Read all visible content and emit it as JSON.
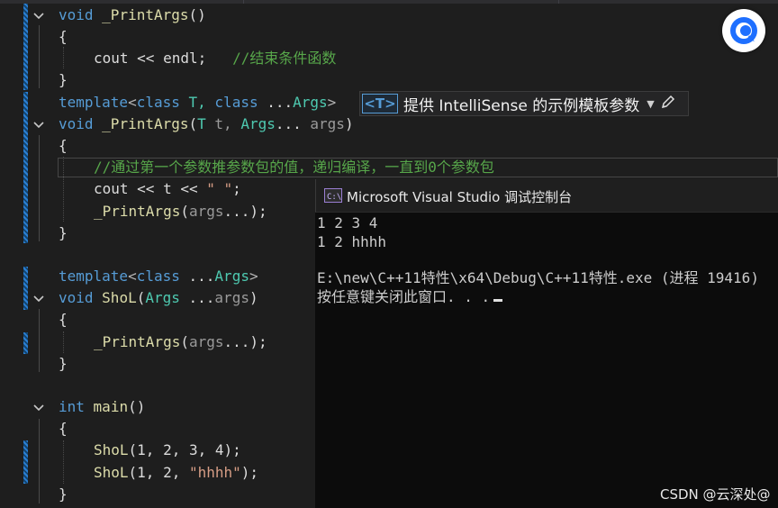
{
  "editor": {
    "lines": {
      "l1": {
        "kw": "void",
        "fn": "_PrintArgs",
        "rest": "()"
      },
      "l2": {
        "text": "{"
      },
      "l3": {
        "a": "cout << endl;",
        "cm": "//结束条件函数"
      },
      "l4": {
        "text": "}"
      },
      "l5": {
        "kw1": "template",
        "p1": "<",
        "kw2": "class",
        "t": "T,",
        "kw3": "class",
        "e": "...",
        "ty": "Args",
        "p2": ">"
      },
      "l6": {
        "kw": "void",
        "fn": "_PrintArgs",
        "a": "(",
        "ty1": "T",
        "pm1": "t,",
        "ty2": "Args",
        "b": "...",
        "pm2": "args",
        ")": ")"
      },
      "l7": {
        "text": "{"
      },
      "l8": {
        "cm": "//通过第一个参数推参数包的值，递归编译，一直到0个参数包"
      },
      "l9": {
        "a": "cout << t << ",
        "str": "\" \"",
        "b": ";"
      },
      "l10": {
        "fn": "_PrintArgs",
        "a": "(",
        "pm": "args",
        "b": "...);"
      },
      "l11": {
        "text": "}"
      },
      "l12": {
        "kw1": "template",
        "p1": "<",
        "kw2": "class",
        "e": "...",
        "ty": "Args",
        "p2": ">"
      },
      "l13": {
        "kw": "void",
        "fn": "ShoL",
        "a": "(",
        "ty": "Args",
        "b": "...",
        "pm": "args",
        ")": ")"
      },
      "l14": {
        "text": "{"
      },
      "l15": {
        "fn": "_PrintArgs",
        "a": "(",
        "pm": "args",
        "b": "...);"
      },
      "l16": {
        "text": "}"
      },
      "l17": {
        "kw": "int",
        "fn": "main",
        "rest": "()"
      },
      "l18": {
        "text": "{"
      },
      "l19": {
        "fn": "ShoL",
        "a": "(1, 2, 3, 4);"
      },
      "l20": {
        "fn": "ShoL",
        "a": "(1, 2, ",
        "str": "\"hhhh\"",
        "b": ");"
      },
      "l21": {
        "text": "}"
      }
    }
  },
  "intellisense_hint": {
    "badge": "<T>",
    "text": "提供 IntelliSense 的示例模板参数",
    "dropdown_icon": "caret-down-icon",
    "edit_icon": "pencil-icon"
  },
  "console": {
    "title": "Microsoft Visual Studio 调试控制台",
    "icon": "console-app-icon",
    "output": [
      "1 2 3 4",
      "1 2 hhhh",
      "",
      "E:\\new\\C++11特性\\x64\\Debug\\C++11特性.exe (进程 19416)",
      "按任意键关闭此窗口. . ."
    ]
  },
  "overlay": {
    "avatar_icon": "assistant-avatar-icon"
  },
  "watermark": "CSDN @云深处@",
  "colors": {
    "keyword": "#569cd6",
    "function": "#dcdcaa",
    "type": "#4ec9b0",
    "comment": "#57a64a",
    "string": "#d69d85",
    "background": "#1e1e1e"
  }
}
